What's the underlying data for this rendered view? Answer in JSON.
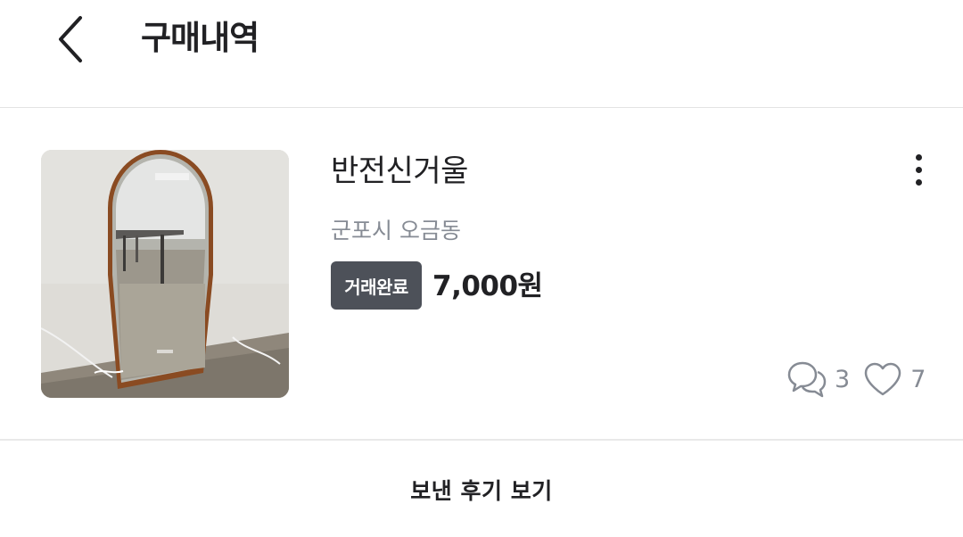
{
  "header": {
    "title": "구매내역",
    "back_icon": "chevron-left-icon"
  },
  "item": {
    "title": "반전신거울",
    "location": "군포시 오금동",
    "status": "거래완료",
    "price": "7,000원",
    "chat_count": "3",
    "like_count": "7",
    "more_icon": "more-vertical-icon",
    "chat_icon": "chat-bubbles-icon",
    "like_icon": "heart-icon"
  },
  "footer": {
    "review_label": "보낸 후기 보기"
  },
  "colors": {
    "text_primary": "#212124",
    "text_secondary": "#868b94",
    "badge_bg": "#4d5159",
    "divider": "#e3e3e3"
  }
}
